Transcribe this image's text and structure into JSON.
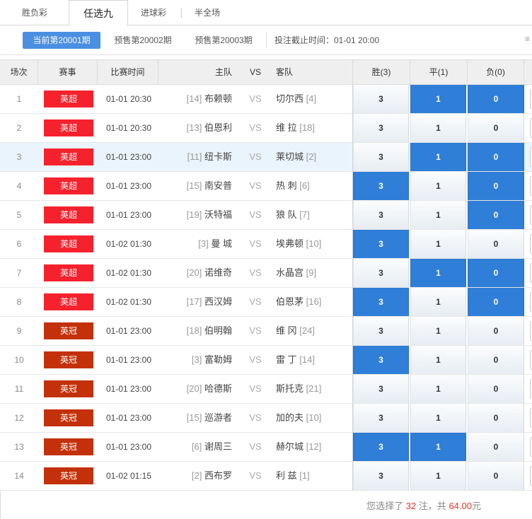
{
  "tabs": [
    {
      "label": "胜负彩",
      "active": false
    },
    {
      "label": "任选九",
      "active": true
    },
    {
      "label": "进球彩",
      "active": false
    },
    {
      "label": "半全场",
      "active": false
    }
  ],
  "issues": [
    {
      "label": "当前第20001期",
      "active": true
    },
    {
      "label": "预售第20002期",
      "active": false
    },
    {
      "label": "预售第20003期",
      "active": false
    }
  ],
  "deadline": "投注截止时间：01-01 20:00",
  "header": {
    "num": "场次",
    "league": "赛事",
    "time": "比赛时间",
    "home": "主队",
    "vs": "VS",
    "away": "客队",
    "win": "胜(3)",
    "draw": "平(1)",
    "lose": "负(0)"
  },
  "rows": [
    {
      "num": "1",
      "league": "英超",
      "time": "01-01 20:30",
      "home_rank": "[14]",
      "home": "布赖顿",
      "vs": "VS",
      "away": "切尔西",
      "away_rank": "[4]",
      "o3": "3",
      "o1": "1",
      "o0": "0",
      "sel3": false,
      "sel1": true,
      "sel0": true
    },
    {
      "num": "2",
      "league": "英超",
      "time": "01-01 20:30",
      "home_rank": "[13]",
      "home": "伯恩利",
      "vs": "VS",
      "away": "维 拉",
      "away_rank": "[18]",
      "o3": "3",
      "o1": "1",
      "o0": "0",
      "sel3": false,
      "sel1": false,
      "sel0": false
    },
    {
      "num": "3",
      "league": "英超",
      "time": "01-01 23:00",
      "home_rank": "[11]",
      "home": "纽卡斯",
      "vs": "VS",
      "away": "莱切城",
      "away_rank": "[2]",
      "o3": "3",
      "o1": "1",
      "o0": "0",
      "sel3": false,
      "sel1": true,
      "sel0": true
    },
    {
      "num": "4",
      "league": "英超",
      "time": "01-01 23:00",
      "home_rank": "[15]",
      "home": "南安普",
      "vs": "VS",
      "away": "热 刺",
      "away_rank": "[6]",
      "o3": "3",
      "o1": "1",
      "o0": "0",
      "sel3": true,
      "sel1": false,
      "sel0": true
    },
    {
      "num": "5",
      "league": "英超",
      "time": "01-01 23:00",
      "home_rank": "[19]",
      "home": "沃特福",
      "vs": "VS",
      "away": "狼 队",
      "away_rank": "[7]",
      "o3": "3",
      "o1": "1",
      "o0": "0",
      "sel3": false,
      "sel1": false,
      "sel0": true
    },
    {
      "num": "6",
      "league": "英超",
      "time": "01-02 01:30",
      "home_rank": "[3]",
      "home": "曼 城",
      "vs": "VS",
      "away": "埃弗顿",
      "away_rank": "[10]",
      "o3": "3",
      "o1": "1",
      "o0": "0",
      "sel3": true,
      "sel1": false,
      "sel0": false
    },
    {
      "num": "7",
      "league": "英超",
      "time": "01-02 01:30",
      "home_rank": "[20]",
      "home": "诺维奇",
      "vs": "VS",
      "away": "水晶宫",
      "away_rank": "[9]",
      "o3": "3",
      "o1": "1",
      "o0": "0",
      "sel3": false,
      "sel1": true,
      "sel0": true
    },
    {
      "num": "8",
      "league": "英超",
      "time": "01-02 01:30",
      "home_rank": "[17]",
      "home": "西汉姆",
      "vs": "VS",
      "away": "伯恩茅",
      "away_rank": "[16]",
      "o3": "3",
      "o1": "1",
      "o0": "0",
      "sel3": true,
      "sel1": false,
      "sel0": true
    },
    {
      "num": "9",
      "league": "英冠",
      "time": "01-01 23:00",
      "home_rank": "[18]",
      "home": "伯明翰",
      "vs": "VS",
      "away": "维 冈",
      "away_rank": "[24]",
      "o3": "3",
      "o1": "1",
      "o0": "0",
      "sel3": false,
      "sel1": false,
      "sel0": false
    },
    {
      "num": "10",
      "league": "英冠",
      "time": "01-01 23:00",
      "home_rank": "[3]",
      "home": "富勒姆",
      "vs": "VS",
      "away": "雷 丁",
      "away_rank": "[14]",
      "o3": "3",
      "o1": "1",
      "o0": "0",
      "sel3": true,
      "sel1": false,
      "sel0": false
    },
    {
      "num": "11",
      "league": "英冠",
      "time": "01-01 23:00",
      "home_rank": "[20]",
      "home": "哈德斯",
      "vs": "VS",
      "away": "斯托克",
      "away_rank": "[21]",
      "o3": "3",
      "o1": "1",
      "o0": "0",
      "sel3": false,
      "sel1": false,
      "sel0": false
    },
    {
      "num": "12",
      "league": "英冠",
      "time": "01-01 23:00",
      "home_rank": "[15]",
      "home": "巡游者",
      "vs": "VS",
      "away": "加的夫",
      "away_rank": "[10]",
      "o3": "3",
      "o1": "1",
      "o0": "0",
      "sel3": false,
      "sel1": false,
      "sel0": false
    },
    {
      "num": "13",
      "league": "英冠",
      "time": "01-01 23:00",
      "home_rank": "[6]",
      "home": "谢周三",
      "vs": "VS",
      "away": "赫尔城",
      "away_rank": "[12]",
      "o3": "3",
      "o1": "1",
      "o0": "0",
      "sel3": true,
      "sel1": true,
      "sel0": false
    },
    {
      "num": "14",
      "league": "英冠",
      "time": "01-02 01:15",
      "home_rank": "[2]",
      "home": "西布罗",
      "vs": "VS",
      "away": "利 兹",
      "away_rank": "[1]",
      "o3": "3",
      "o1": "1",
      "o0": "0",
      "sel3": false,
      "sel1": false,
      "sel0": false
    }
  ],
  "summary": {
    "prefix": "您选择了",
    "count": "32",
    "mid": "注，共",
    "amount": "64.00",
    "suffix": "元"
  },
  "colors": {
    "accent": "#2f7ed8",
    "epl": "#f5222d",
    "efl": "#c3310a",
    "tab_active": "#4a8fe2"
  }
}
